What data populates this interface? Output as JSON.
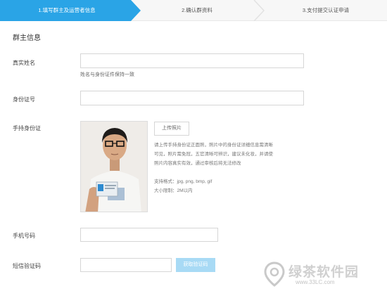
{
  "steps": [
    {
      "label": "1.填写群主及运营者信息",
      "active": true
    },
    {
      "label": "2.确认群资料",
      "active": false
    },
    {
      "label": "3.支付提交认证申请",
      "active": false
    }
  ],
  "section_title": "群主信息",
  "fields": {
    "real_name": {
      "label": "真实姓名",
      "value": "",
      "hint": "姓名与身份证件保持一致"
    },
    "id_number": {
      "label": "身份证号",
      "value": ""
    },
    "id_photo": {
      "label": "手持身份证",
      "upload_label": "上传照片",
      "description": "请上传手持身份证正面照，照片中的身份证详细信息需清晰可见，照片需免冠，五官清晰可辨识，建议未化妆，并请使照片内容真实有效，通过审核后将无法修改",
      "formats": "支持格式：jpg, png, bmp, gif",
      "size_limit": "大小限制：2M以内"
    },
    "phone": {
      "label": "手机号码",
      "value": ""
    },
    "sms_code": {
      "label": "短信验证码",
      "value": "",
      "button_label": "获取验证码"
    }
  },
  "watermark": {
    "text": "绿茶软件园",
    "url": "www.33LC.com"
  },
  "colors": {
    "accent": "#2aa4e6",
    "sms_button": "#a8daf5"
  }
}
